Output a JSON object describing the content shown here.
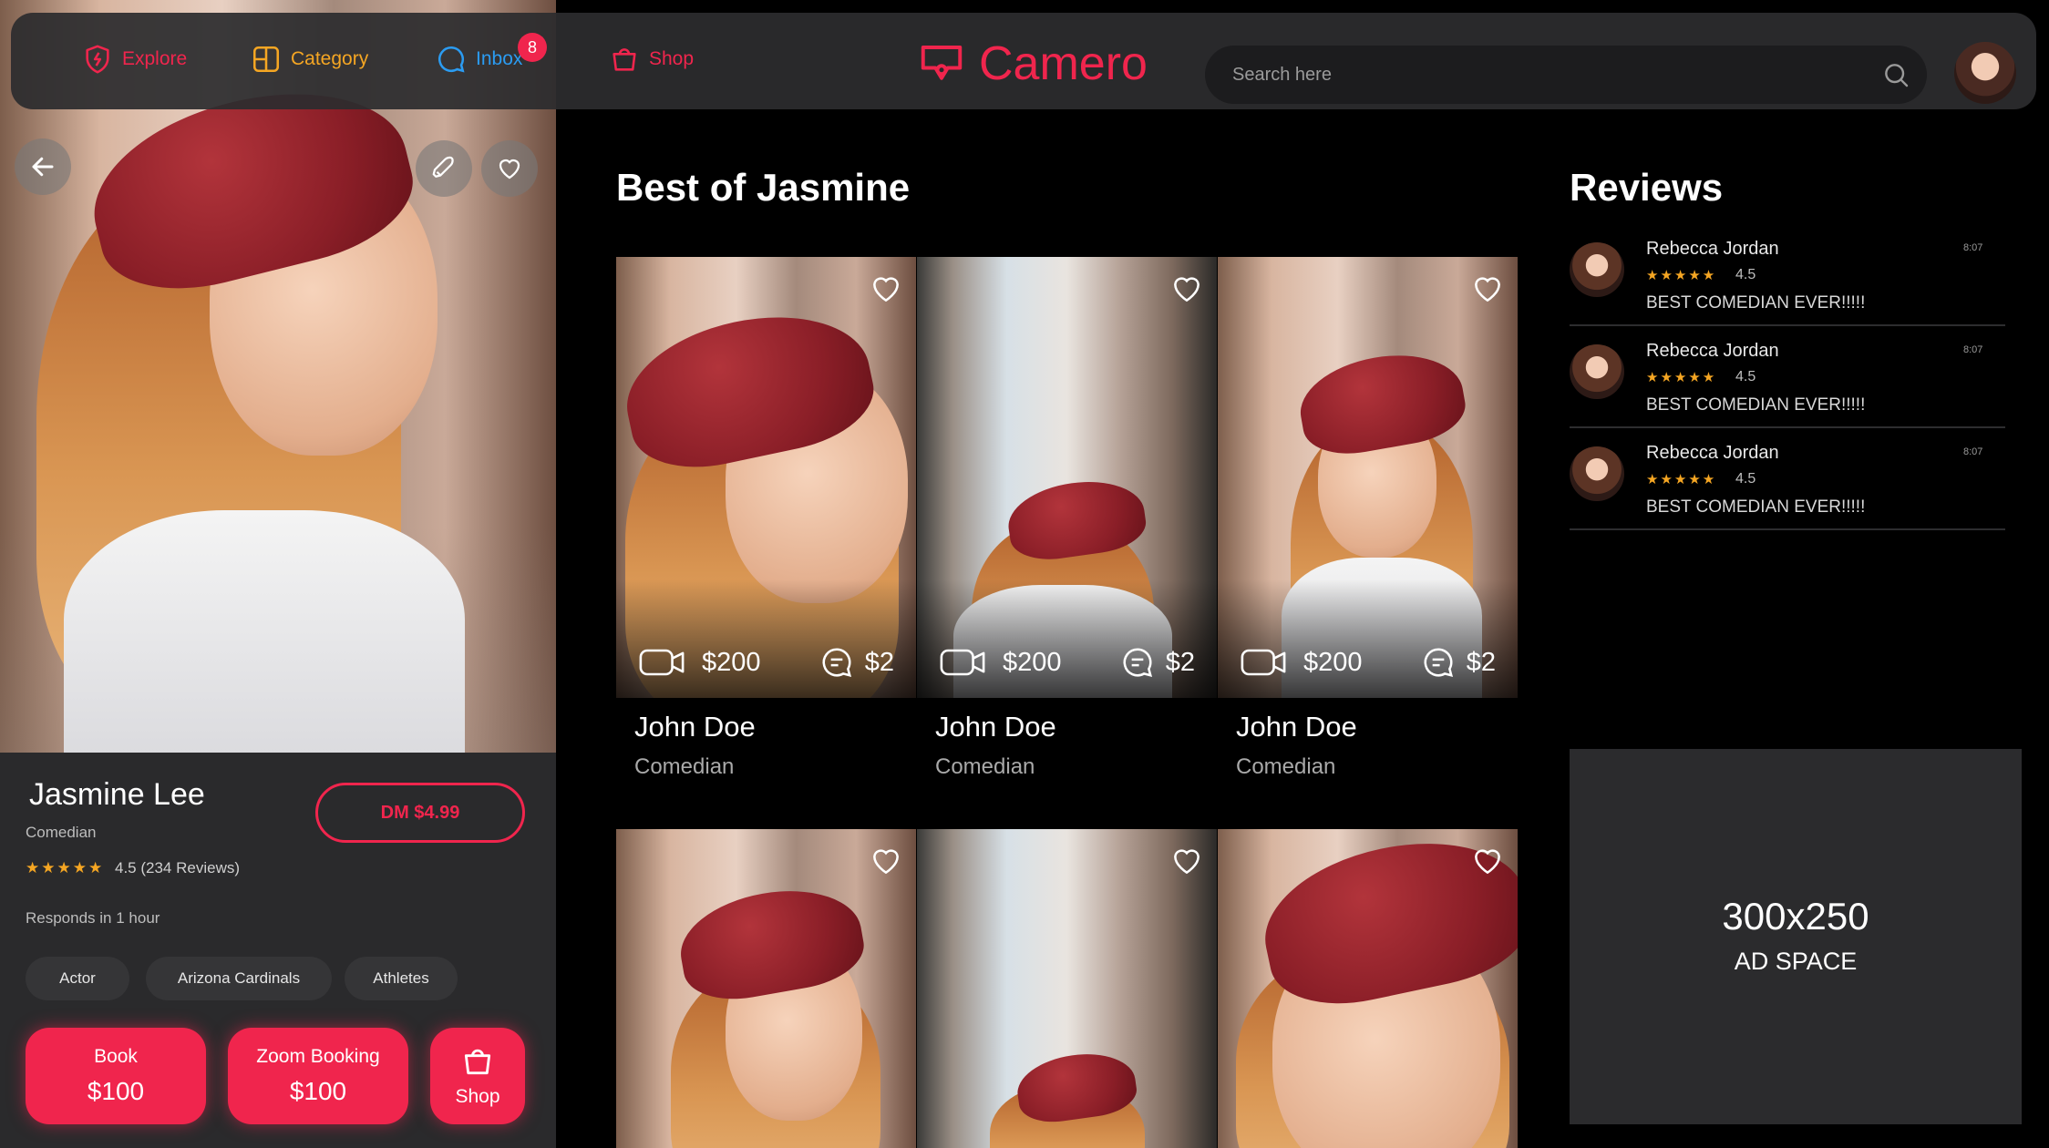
{
  "nav": {
    "items": [
      {
        "label": "Explore",
        "icon": "shield-bolt-icon",
        "color": "#f0254d"
      },
      {
        "label": "Category",
        "icon": "grid-icon",
        "color": "#f5a623"
      },
      {
        "label": "Inbox",
        "icon": "chat-bubble-icon",
        "color": "#2b9cf2",
        "badge": "8"
      },
      {
        "label": "Shop",
        "icon": "shopping-bag-icon",
        "color": "#f0254d"
      }
    ],
    "logo_text": "Camero",
    "search_placeholder": "Search here"
  },
  "profile": {
    "name": "Jasmine Lee",
    "role": "Comedian",
    "stars": "★★★★★",
    "rating_text": "4.5 (234 Reviews)",
    "responds": "Responds in 1 hour",
    "dm_label": "DM $4.99",
    "tags": [
      "Actor",
      "Arizona Cardinals",
      "Athletes"
    ],
    "actions": [
      {
        "line1": "Book",
        "line2": "$100"
      },
      {
        "line1": "Zoom Booking",
        "line2": "$100"
      },
      {
        "line1": "Shop"
      }
    ]
  },
  "best": {
    "title": "Best of Jasmine",
    "cards": [
      {
        "name": "John Doe",
        "role": "Comedian",
        "video_price": "$200",
        "chat_price": "$2"
      },
      {
        "name": "John Doe",
        "role": "Comedian",
        "video_price": "$200",
        "chat_price": "$2"
      },
      {
        "name": "John Doe",
        "role": "Comedian",
        "video_price": "$200",
        "chat_price": "$2"
      }
    ]
  },
  "reviews": {
    "title": "Reviews",
    "items": [
      {
        "name": "Rebecca Jordan",
        "time": "8:07",
        "stars": "★★★★★",
        "rating": "4.5",
        "text": "BEST COMEDIAN EVER!!!!!"
      },
      {
        "name": "Rebecca Jordan",
        "time": "8:07",
        "stars": "★★★★★",
        "rating": "4.5",
        "text": "BEST COMEDIAN EVER!!!!!"
      },
      {
        "name": "Rebecca Jordan",
        "time": "8:07",
        "stars": "★★★★★",
        "rating": "4.5",
        "text": "BEST COMEDIAN EVER!!!!!"
      }
    ]
  },
  "ad": {
    "size": "300x250",
    "label": "AD SPACE"
  },
  "colors": {
    "accent": "#f0254d",
    "star": "#f5a623",
    "panel": "#2a2a2c",
    "background": "#000000"
  }
}
